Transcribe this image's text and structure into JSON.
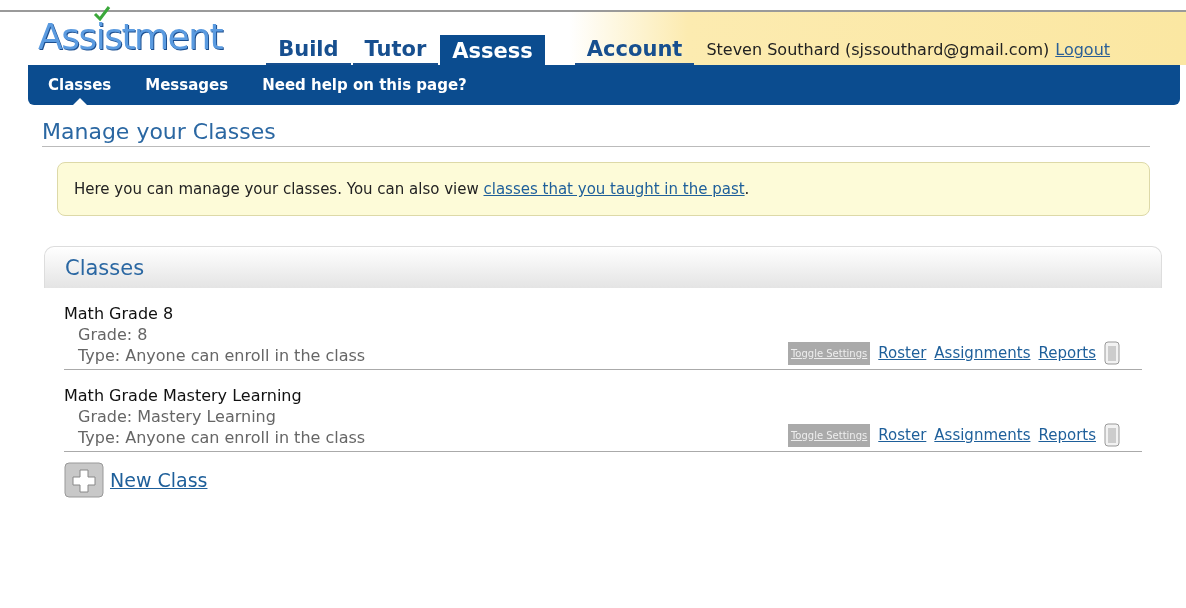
{
  "logo": {
    "text": "Assistment"
  },
  "tabs": [
    {
      "label": "Build",
      "selected": false
    },
    {
      "label": "Tutor",
      "selected": false
    },
    {
      "label": "Assess",
      "selected": true
    },
    {
      "label": "Account",
      "selected": false
    }
  ],
  "user": {
    "name": "Steven Southard (sjssouthard@gmail.com)",
    "logout": "Logout"
  },
  "subnav": [
    {
      "label": "Classes",
      "selected": true
    },
    {
      "label": "Messages",
      "selected": false
    },
    {
      "label": "Need help on this page?",
      "selected": false
    }
  ],
  "heading": "Manage your Classes",
  "notice": {
    "text": "Here you can manage your classes. You can also view ",
    "link": "classes that you taught in the past",
    "end": "."
  },
  "panel_title": "Classes",
  "classes": [
    {
      "name": "Math Grade 8",
      "grade": "Grade: 8",
      "type": "Type: Anyone can enroll in the class",
      "toggle": "Toggle Settings",
      "links": [
        "Roster",
        "Assignments",
        "Reports"
      ]
    },
    {
      "name": "Math Grade Mastery Learning",
      "grade": "Grade: Mastery Learning",
      "type": "Type: Anyone can enroll in the class",
      "toggle": "Toggle Settings",
      "links": [
        "Roster",
        "Assignments",
        "Reports"
      ]
    }
  ],
  "new_class": "New Class"
}
